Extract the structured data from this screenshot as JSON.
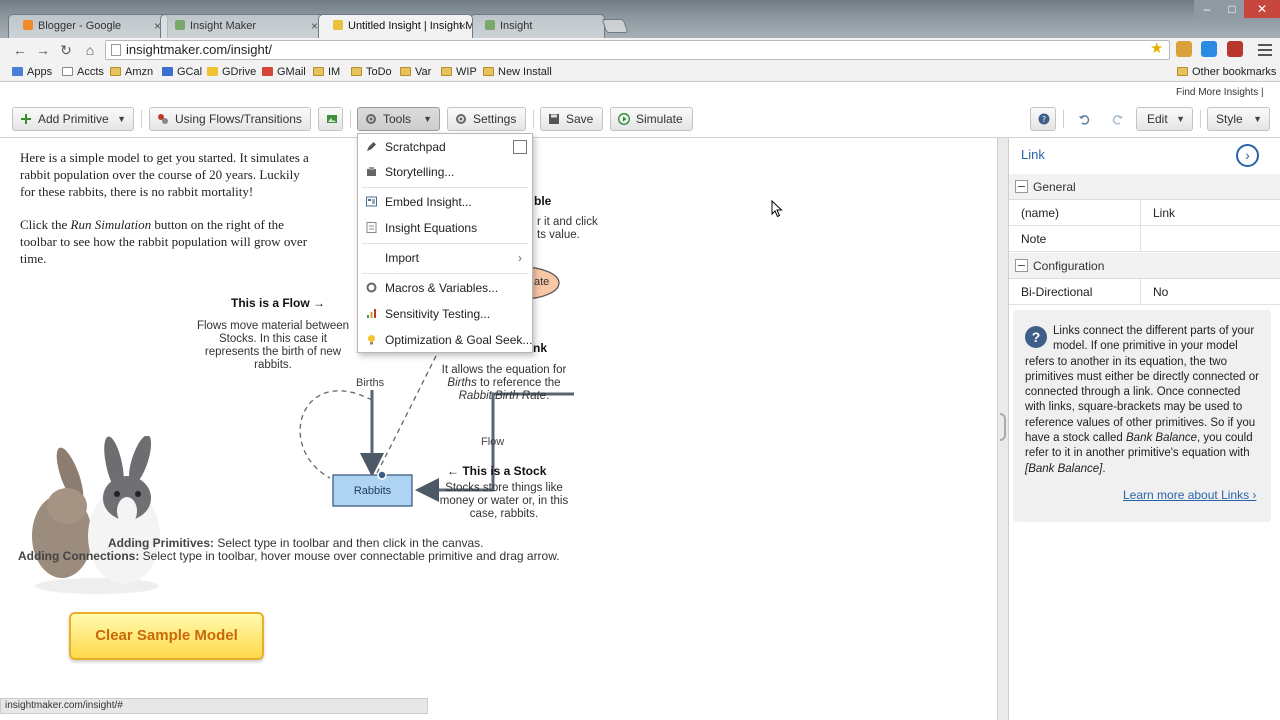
{
  "browser": {
    "tabs": [
      {
        "label": "Blogger - Google",
        "active": false
      },
      {
        "label": "Insight Maker",
        "active": false
      },
      {
        "label": "Untitled Insight | Insight M",
        "active": true
      },
      {
        "label": "Insight",
        "active": false
      }
    ],
    "tab_close": "×",
    "window_controls": {
      "minimize": "–",
      "maximize": "□",
      "close": "✕"
    },
    "url": "insightmaker.com/insight/",
    "bookmarks": [
      "Apps",
      "Accts",
      "Amzn",
      "GCal",
      "GDrive",
      "GMail",
      "IM",
      "ToDo",
      "Var",
      "WIP",
      "New Install"
    ],
    "other_bookmarks": "Other bookmarks",
    "status_url": "insightmaker.com/insight/#"
  },
  "app": {
    "find_more": "Find More Insights |",
    "toolbar": {
      "add_primitive": "Add Primitive",
      "using_flows": "Using Flows/Transitions",
      "tools": "Tools",
      "settings": "Settings",
      "save": "Save",
      "simulate": "Simulate",
      "edit": "Edit",
      "style": "Style"
    },
    "tools_menu": {
      "items": [
        "Scratchpad",
        "Storytelling...",
        "Embed Insight...",
        "Insight Equations",
        "Import",
        "Macros & Variables...",
        "Sensitivity Testing...",
        "Optimization & Goal Seek..."
      ],
      "submenu_arrow": "›"
    },
    "canvas": {
      "intro_1a": "Here is a simple model to get you started. It simulates a",
      "intro_1b": "rabbit population over the course of 20 years. Luckily",
      "intro_1c": "for these rabbits, there is no rabbit mortality!",
      "intro_2a": "Click the",
      "intro_2b": "Run Simulation",
      "intro_2c": "button on the right of the",
      "intro_2d": "toolbar to see how the rabbit population will grow over",
      "intro_2e": "time.",
      "flow_title": "This is a Flow →",
      "flow_desc": [
        "Flows move material between",
        "Stocks. In this case it",
        "represents the birth of new",
        "rabbits."
      ],
      "variable_title_tail": "ble",
      "variable_desc_a": "r it and click",
      "variable_desc_b": "ts value.",
      "link_title_tail": "nk",
      "link_desc_a": "It allows the equation for",
      "link_desc_b1": "Births",
      "link_desc_b2": " to reference the",
      "link_desc_c": "Rabbit Birth Rate",
      "link_desc_c2": ".",
      "stock_title": "← This is a Stock",
      "stock_desc": [
        "Stocks store things like",
        "money or water or, in this",
        "case, rabbits."
      ],
      "births_label": "Births",
      "flow_label": "Flow",
      "rate_label_tail": "ate",
      "stock_label": "Rabbits",
      "clear_button": "Clear Sample Model",
      "hint_primitives_label": "Adding Primitives:",
      "hint_primitives": "Select type in toolbar and then click in the canvas.",
      "hint_connections_label": "Adding Connections:",
      "hint_connections": "Select type in toolbar, hover mouse over connectable primitive and drag arrow."
    },
    "panel": {
      "title": "Link",
      "collapse_icon": "›",
      "groups": {
        "general": "General",
        "configuration": "Configuration"
      },
      "rows": {
        "name_key": "(name)",
        "name_val": "Link",
        "note_key": "Note",
        "note_val": "",
        "bidir_key": "Bi-Directional",
        "bidir_val": "No"
      },
      "help_icon": "?",
      "help_a": "Links connect the different parts of your model. If one primitive in your model refers to another in its equation, the two primitives must either be directly connected or connected through a link. Once connected with links, square-brackets may be used to reference values of other primitives. So if you have a stock called",
      "help_em1": "Bank Balance",
      "help_b": ", you could refer to it in another primitive's equation with",
      "help_em2": "[Bank Balance]",
      "help_c": ".",
      "learn_more": "Learn more about Links ›"
    }
  }
}
